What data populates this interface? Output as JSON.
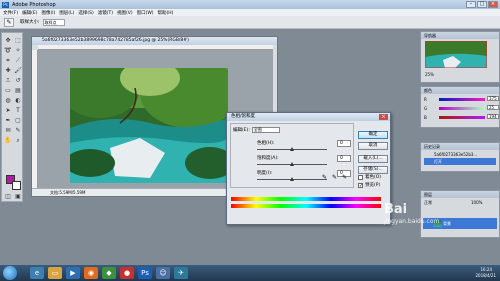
{
  "app": {
    "title": "Adobe Photoshop",
    "ps_logo": "Ps"
  },
  "menu": {
    "items": [
      "文件(F)",
      "编辑(E)",
      "图像(I)",
      "图层(L)",
      "选择(S)",
      "滤镜(T)",
      "视图(V)",
      "窗口(W)",
      "帮助(H)"
    ]
  },
  "options": {
    "label": "取样大小:",
    "value": "取样点"
  },
  "document": {
    "title": "5a6f0273363e52b3899698c78a742785af26.jpg @ 25%(RGB/8#)",
    "status": "文档:5.59M/5.59M"
  },
  "dialog": {
    "title": "色相/饱和度",
    "edit_label": "编辑(E):",
    "edit_value": "全图",
    "hue_label": "色相(H):",
    "hue_value": "0",
    "sat_label": "饱和度(A):",
    "sat_value": "0",
    "light_label": "明度(I):",
    "light_value": "0",
    "ok": "确定",
    "cancel": "取消",
    "load": "载入(L)...",
    "save": "存储(S)...",
    "colorize": "着色(O)",
    "preview": "预览(P)",
    "preview_checked": true,
    "colorize_checked": false,
    "hue_level": 0.5,
    "sat_level": 0.5,
    "light_level": 0.5
  },
  "panels": {
    "navigator_tab": "导航器",
    "navigator_zoom": "25%",
    "color_tab": "颜色",
    "color_values": [
      "175",
      "25",
      "194"
    ],
    "color_labels": [
      "R",
      "G",
      "B"
    ],
    "history_tab": "历史记录",
    "history_items": [
      "5a6f0273363e52b3...",
      "打开"
    ],
    "layers_tab": "图层",
    "layer_blend": "正常",
    "layer_opacity": "100%",
    "layer_name": "背景"
  },
  "taskbar": {
    "time": "16:24",
    "date": "2018/4/21"
  },
  "watermark": {
    "main": "Bai",
    "sub": "jingyan.baidu.com"
  },
  "colors": {
    "foreground": "#b01aa8",
    "accent": "#3d78d6"
  }
}
